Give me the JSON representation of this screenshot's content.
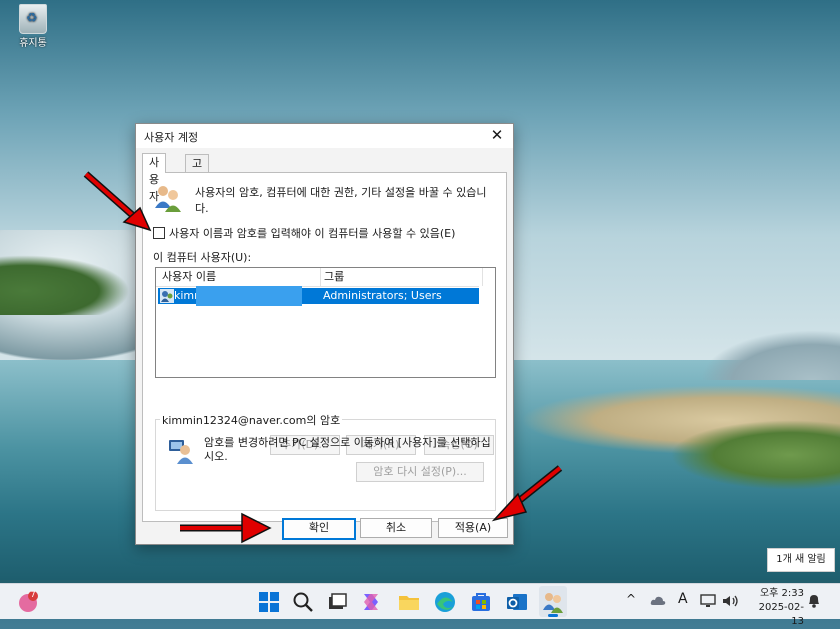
{
  "desktop": {
    "recycle_bin_label": "휴지통"
  },
  "dialog": {
    "title": "사용자 계정",
    "close_glyph": "✕",
    "tabs": [
      {
        "label": "사용자"
      },
      {
        "label": "고급"
      }
    ],
    "description": "사용자의 암호, 컴퓨터에 대한 권한, 기타 설정을 바꿀 수 있습니다.",
    "checkbox_label": "사용자 이름과 암호를 입력해야 이 컴퓨터를 사용할 수 있음(E)",
    "checkbox_checked": false,
    "users_label": "이 컴퓨터 사용자(U):",
    "columns": {
      "name": "사용자 이름",
      "group": "그룹"
    },
    "rows": [
      {
        "name": "kimm",
        "group": "Administrators; Users",
        "selected": true
      }
    ],
    "buttons": {
      "add": "추가(D)...",
      "remove": "제거(R)",
      "properties": "속성(O)"
    },
    "password_group": {
      "title": "kimmin12324@naver.com의 암호",
      "text": "암호를 변경하려면 PC 설정으로 이동하여 [사용자]를 선택하십시오.",
      "reset_button": "암호 다시 설정(P)..."
    },
    "footer": {
      "ok": "확인",
      "cancel": "취소",
      "apply": "적용(A)"
    }
  },
  "notification": {
    "text": "1개 새 알림"
  },
  "taskbar": {
    "widget_badge": "7",
    "icons": [
      "start-icon",
      "search-icon",
      "task-view-icon",
      "copilot-icon",
      "file-explorer-icon",
      "edge-icon",
      "store-icon",
      "outlook-icon",
      "user-accounts-icon"
    ],
    "tray": {
      "chevron": "^",
      "ime": "A"
    },
    "clock": {
      "time": "오후 2:33",
      "date": "2025-02-13"
    }
  },
  "colors": {
    "selection": "#0078d7",
    "arrow": "#e00000",
    "taskbar": "#eef1f5"
  }
}
